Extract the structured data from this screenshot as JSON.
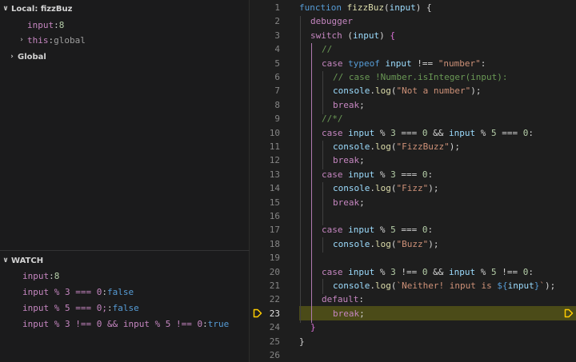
{
  "debug": {
    "local_scope": {
      "label": "Local: fizzBuz",
      "twisty": "∨",
      "vars": [
        {
          "name": "input",
          "sep": ": ",
          "value": "8"
        },
        {
          "name": "this",
          "sep": ": ",
          "value": "global",
          "twisty": "›"
        }
      ]
    },
    "global_scope": {
      "label": "Global",
      "twisty": "›"
    },
    "watch": {
      "label": "WATCH",
      "twisty": "∨",
      "items": [
        {
          "expr": "input",
          "sep": ": ",
          "value": "8"
        },
        {
          "expr": "input % 3 === 0",
          "sep": ": ",
          "value": "false"
        },
        {
          "expr": "input % 5 === 0;",
          "sep": ": ",
          "value": "false"
        },
        {
          "expr": "input % 3 !== 0 && input % 5 !== 0",
          "sep": ": ",
          "value": "true"
        }
      ]
    }
  },
  "editor": {
    "current_line": 23,
    "line_numbers": [
      "1",
      "2",
      "3",
      "4",
      "5",
      "6",
      "7",
      "8",
      "9",
      "10",
      "11",
      "12",
      "13",
      "14",
      "15",
      "16",
      "17",
      "18",
      "19",
      "20",
      "21",
      "22",
      "23",
      "24",
      "25",
      "26"
    ],
    "lines": [
      {
        "indent": 0,
        "tokens": [
          [
            "kw",
            "function "
          ],
          [
            "fn",
            "fizzBuz"
          ],
          [
            "op",
            "("
          ],
          [
            "var",
            "input"
          ],
          [
            "op",
            ") {"
          ]
        ]
      },
      {
        "indent": 1,
        "tokens": [
          [
            "ctl",
            "debugger"
          ]
        ]
      },
      {
        "indent": 1,
        "tokens": [
          [
            "ctl",
            "switch "
          ],
          [
            "op",
            "("
          ],
          [
            "var",
            "input"
          ],
          [
            "op",
            ") "
          ],
          [
            "brace",
            "{"
          ]
        ]
      },
      {
        "indent": 2,
        "tokens": [
          [
            "cmt",
            "//"
          ]
        ]
      },
      {
        "indent": 2,
        "tokens": [
          [
            "ctl",
            "case "
          ],
          [
            "kw",
            "typeof "
          ],
          [
            "var",
            "input"
          ],
          [
            "op",
            " !== "
          ],
          [
            "str",
            "\"number\""
          ],
          [
            "op",
            ":"
          ]
        ]
      },
      {
        "indent": 3,
        "tokens": [
          [
            "cmt",
            "// case !Number.isInteger(input):"
          ]
        ]
      },
      {
        "indent": 3,
        "tokens": [
          [
            "var",
            "console"
          ],
          [
            "op",
            "."
          ],
          [
            "fn",
            "log"
          ],
          [
            "op",
            "("
          ],
          [
            "str",
            "\"Not a number\""
          ],
          [
            "op",
            ");"
          ]
        ]
      },
      {
        "indent": 3,
        "tokens": [
          [
            "ctl",
            "break"
          ],
          [
            "op",
            ";"
          ]
        ]
      },
      {
        "indent": 2,
        "tokens": [
          [
            "cmt",
            "//*/"
          ]
        ]
      },
      {
        "indent": 2,
        "tokens": [
          [
            "ctl",
            "case "
          ],
          [
            "var",
            "input"
          ],
          [
            "op",
            " % "
          ],
          [
            "num",
            "3"
          ],
          [
            "op",
            " === "
          ],
          [
            "num",
            "0"
          ],
          [
            "op",
            " && "
          ],
          [
            "var",
            "input"
          ],
          [
            "op",
            " % "
          ],
          [
            "num",
            "5"
          ],
          [
            "op",
            " === "
          ],
          [
            "num",
            "0"
          ],
          [
            "op",
            ":"
          ]
        ]
      },
      {
        "indent": 3,
        "tokens": [
          [
            "var",
            "console"
          ],
          [
            "op",
            "."
          ],
          [
            "fn",
            "log"
          ],
          [
            "op",
            "("
          ],
          [
            "str",
            "\"FizzBuzz\""
          ],
          [
            "op",
            ");"
          ]
        ]
      },
      {
        "indent": 3,
        "tokens": [
          [
            "ctl",
            "break"
          ],
          [
            "op",
            ";"
          ]
        ]
      },
      {
        "indent": 2,
        "tokens": [
          [
            "ctl",
            "case "
          ],
          [
            "var",
            "input"
          ],
          [
            "op",
            " % "
          ],
          [
            "num",
            "3"
          ],
          [
            "op",
            " === "
          ],
          [
            "num",
            "0"
          ],
          [
            "op",
            ":"
          ]
        ]
      },
      {
        "indent": 3,
        "tokens": [
          [
            "var",
            "console"
          ],
          [
            "op",
            "."
          ],
          [
            "fn",
            "log"
          ],
          [
            "op",
            "("
          ],
          [
            "str",
            "\"Fizz\""
          ],
          [
            "op",
            ");"
          ]
        ]
      },
      {
        "indent": 3,
        "tokens": [
          [
            "ctl",
            "break"
          ],
          [
            "op",
            ";"
          ]
        ]
      },
      {
        "indent": 0,
        "tokens": []
      },
      {
        "indent": 2,
        "tokens": [
          [
            "ctl",
            "case "
          ],
          [
            "var",
            "input"
          ],
          [
            "op",
            " % "
          ],
          [
            "num",
            "5"
          ],
          [
            "op",
            " === "
          ],
          [
            "num",
            "0"
          ],
          [
            "op",
            ":"
          ]
        ]
      },
      {
        "indent": 3,
        "tokens": [
          [
            "var",
            "console"
          ],
          [
            "op",
            "."
          ],
          [
            "fn",
            "log"
          ],
          [
            "op",
            "("
          ],
          [
            "str",
            "\"Buzz\""
          ],
          [
            "op",
            ");"
          ]
        ]
      },
      {
        "indent": 0,
        "tokens": []
      },
      {
        "indent": 2,
        "tokens": [
          [
            "ctl",
            "case "
          ],
          [
            "var",
            "input"
          ],
          [
            "op",
            " % "
          ],
          [
            "num",
            "3"
          ],
          [
            "op",
            " !== "
          ],
          [
            "num",
            "0"
          ],
          [
            "op",
            " && "
          ],
          [
            "var",
            "input"
          ],
          [
            "op",
            " % "
          ],
          [
            "num",
            "5"
          ],
          [
            "op",
            " !== "
          ],
          [
            "num",
            "0"
          ],
          [
            "op",
            ":"
          ]
        ]
      },
      {
        "indent": 3,
        "tokens": [
          [
            "var",
            "console"
          ],
          [
            "op",
            "."
          ],
          [
            "fn",
            "log"
          ],
          [
            "op",
            "("
          ],
          [
            "str",
            "`Neither! input is "
          ],
          [
            "tpl",
            "${"
          ],
          [
            "var",
            "input"
          ],
          [
            "tpl",
            "}"
          ],
          [
            "str",
            "`"
          ],
          [
            "op",
            ");"
          ]
        ]
      },
      {
        "indent": 2,
        "tokens": [
          [
            "ctl",
            "default"
          ],
          [
            "op",
            ":"
          ]
        ]
      },
      {
        "indent": 3,
        "tokens": [
          [
            "ctl",
            "break"
          ],
          [
            "op",
            ";"
          ]
        ]
      },
      {
        "indent": 1,
        "tokens": [
          [
            "brace",
            "}"
          ]
        ]
      },
      {
        "indent": 0,
        "tokens": [
          [
            "op",
            "}"
          ]
        ]
      },
      {
        "indent": 0,
        "tokens": []
      }
    ]
  },
  "colors": {
    "background": "#1e1e1e",
    "panel": "#1b1b1c",
    "current_line": "#4b4b18",
    "debug_arrow": "#ffcc00"
  }
}
